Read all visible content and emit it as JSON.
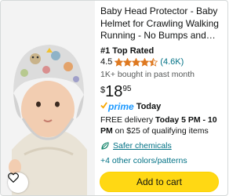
{
  "product": {
    "title": "Baby Head Protector - Baby Helmet for Crawling Walking Running - No Bumps and Softer Falls",
    "badge": "#1 Top Rated",
    "rating": "4.5",
    "rating_value": 4.5,
    "review_count": "(4.6K)",
    "bought": "1K+ bought in past month",
    "price": {
      "symbol": "$",
      "whole": "18",
      "fraction": "95"
    },
    "prime_label": "prime",
    "prime_day": "Today",
    "delivery": {
      "prefix": "FREE delivery ",
      "window": "Today 5 PM - 10 PM",
      "suffix": " on $25 of qualifying items"
    },
    "safer_chemicals": "Safer chemicals",
    "other_options": "+4 other colors/patterns",
    "add_to_cart": "Add to cart"
  },
  "colors": {
    "link": "#007185",
    "prime": "#1a98ff",
    "star": "#de7921",
    "button": "#ffd814"
  },
  "icons": {
    "wishlist": "heart-icon",
    "safer": "leaf-icon",
    "prime": "prime-check-icon",
    "star": "star-icon"
  }
}
